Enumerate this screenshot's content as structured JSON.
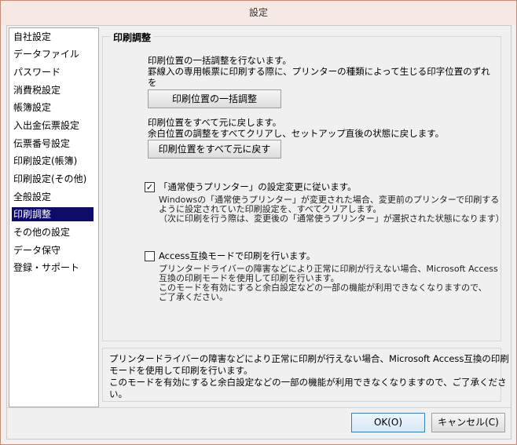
{
  "window": {
    "title": "設定"
  },
  "sidebar": {
    "items": [
      {
        "label": "自社設定"
      },
      {
        "label": "データファイル"
      },
      {
        "label": "パスワード"
      },
      {
        "label": "消費税設定"
      },
      {
        "label": "帳簿設定"
      },
      {
        "label": "入出金伝票設定"
      },
      {
        "label": "伝票番号設定"
      },
      {
        "label": "印刷設定(帳簿)"
      },
      {
        "label": "印刷設定(その他)"
      },
      {
        "label": "全般設定"
      },
      {
        "label": "印刷調整",
        "selected": true
      },
      {
        "label": "その他の設定"
      },
      {
        "label": "データ保守"
      },
      {
        "label": "登録・サポート"
      }
    ]
  },
  "panel": {
    "title": "印刷調整",
    "batch": {
      "line1": "印刷位置の一括調整を行ないます。",
      "line2": "罫線入の専用帳票に印刷する際に、プリンターの種類によって生じる印字位置のずれ",
      "line3": "を",
      "button": "印刷位置の一括調整"
    },
    "reset": {
      "line1": "印刷位置をすべて元に戻します。",
      "line2": "余白位置の調整をすべてクリアし、セットアップ直後の状態に戻します。",
      "button": "印刷位置をすべて元に戻す"
    },
    "printer_option": {
      "checked": true,
      "label": "「通常使うプリンター」の設定変更に従います。",
      "desc1": "Windowsの「通常使うプリンター」が変更された場合、変更前のプリンターで印刷する",
      "desc2": "ように設定されていた印刷設定を、すべてクリアします。",
      "desc3": "（次に印刷を行う際は、変更後の「通常使うプリンター」が選択された状態になります）"
    },
    "access_option": {
      "checked": false,
      "label": "Access互換モードで印刷を行います。",
      "desc1": "プリンタードライバーの障害などにより正常に印刷が行えない場合、Microsoft Access",
      "desc2": "互換の印刷モードを使用して印刷を行います。",
      "desc3": "このモードを有効にすると余白設定などの一部の機能が利用できなくなりますので、",
      "desc4": "ご了承ください。"
    }
  },
  "help": {
    "line1": "プリンタードライバーの障害などにより正常に印刷が行えない場合、Microsoft Access互換の印刷",
    "line2": "モードを使用して印刷を行います。",
    "line3": "このモードを有効にすると余白設定などの一部の機能が利用できなくなりますので、ご了承くださ",
    "line4": "い。"
  },
  "footer": {
    "ok_label": "OK(O)",
    "cancel_label": "キャンセル(C)"
  },
  "check_glyph": "✓"
}
